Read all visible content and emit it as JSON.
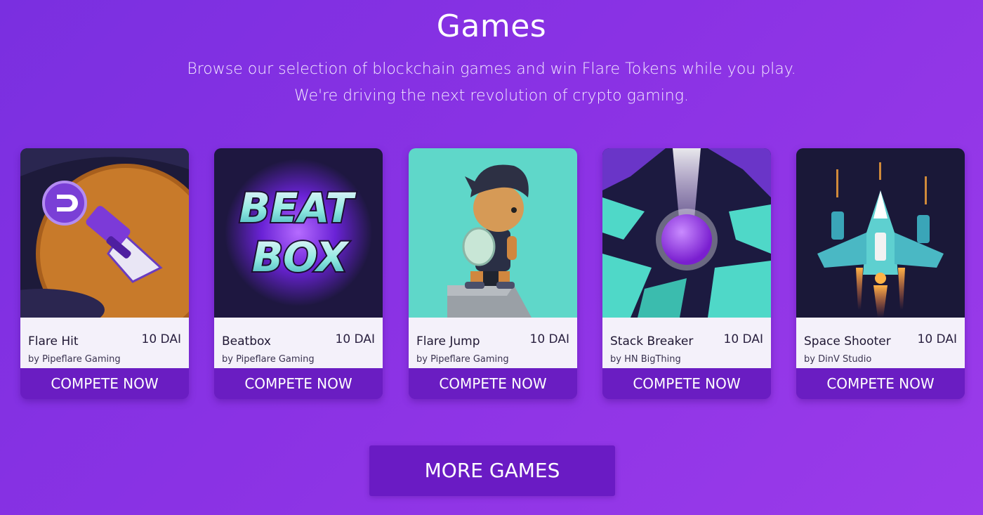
{
  "section": {
    "title": "Games",
    "subtitle_line1": "Browse our selection of blockchain games and win Flare Tokens while you play.",
    "subtitle_line2": "We're driving the next revolution of crypto gaming."
  },
  "games": [
    {
      "name": "Flare Hit",
      "price": "10 DAI",
      "studio": "by Pipeflare Gaming",
      "cta": "COMPETE NOW"
    },
    {
      "name": "Beatbox",
      "price": "10 DAI",
      "studio": "by Pipeflare Gaming",
      "cta": "COMPETE NOW",
      "art_text_1": "BEAT",
      "art_text_2": "BOX"
    },
    {
      "name": "Flare Jump",
      "price": "10 DAI",
      "studio": "by Pipeflare Gaming",
      "cta": "COMPETE NOW"
    },
    {
      "name": "Stack Breaker",
      "price": "10 DAI",
      "studio": "by HN BigThing",
      "cta": "COMPETE NOW"
    },
    {
      "name": "Space Shooter",
      "price": "10 DAI",
      "studio": "by DinV Studio",
      "cta": "COMPETE NOW"
    }
  ],
  "more_button": "MORE GAMES",
  "colors": {
    "background": "#8a32e4",
    "button": "#6a1dc2",
    "card_info": "#f4f1fa"
  }
}
